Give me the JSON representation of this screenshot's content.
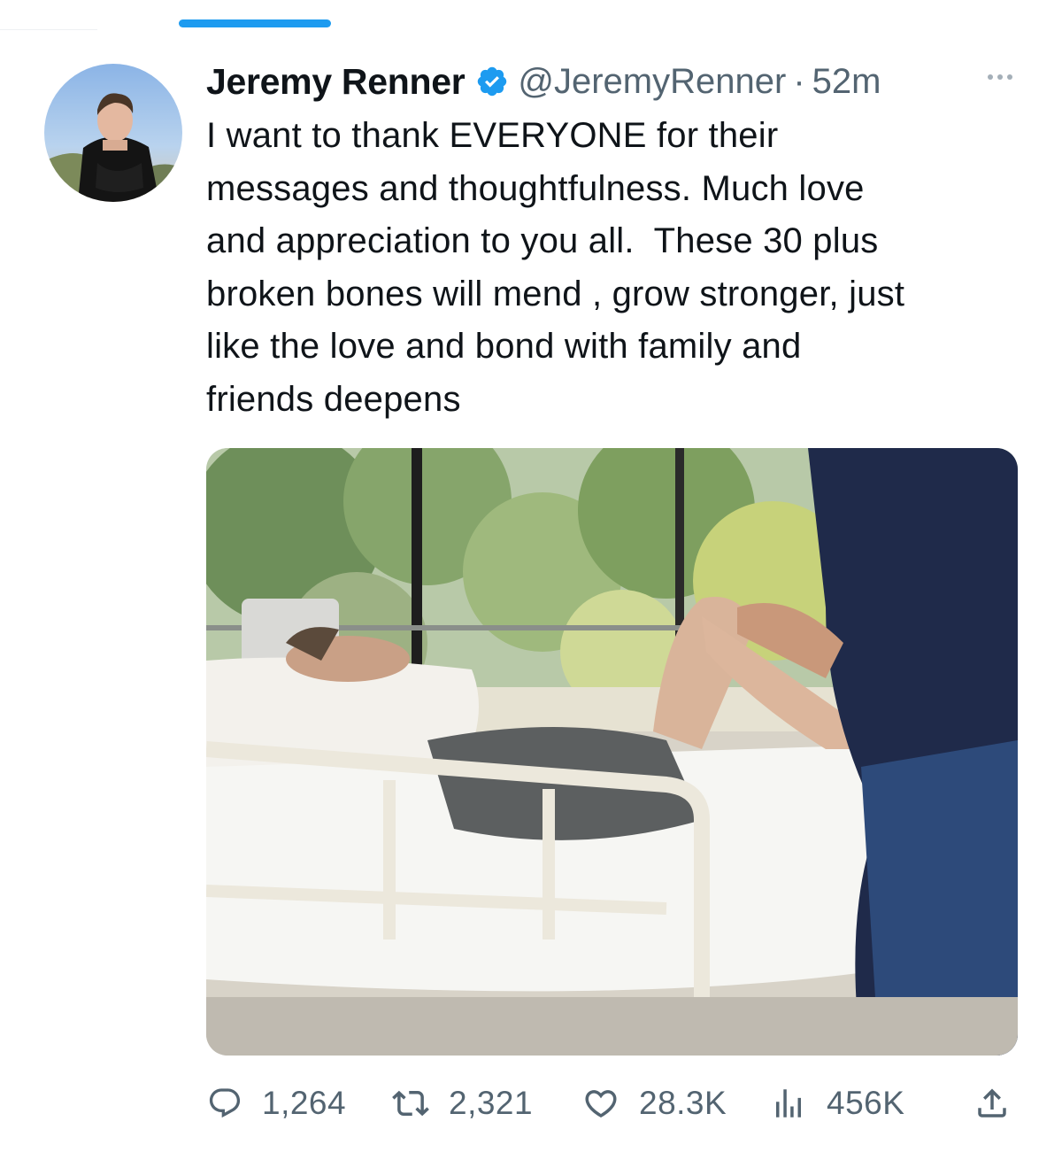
{
  "colors": {
    "accent": "#1d9bf0",
    "muted": "#536471",
    "text": "#0f1419"
  },
  "tweet": {
    "display_name": "Jeremy Renner",
    "handle": "@JeremyRenner",
    "separator": "·",
    "time": "52m",
    "text_lines": [
      "I want to thank EVERYONE for their",
      "messages and thoughtfulness. Much love",
      "and appreciation to you all.  These 30 plus",
      "broken bones will mend , grow stronger, just",
      "like the love and bond with family and",
      "friends deepens"
    ]
  },
  "icons": {
    "avatar": "profile-photo",
    "verified": "verified-badge-icon",
    "more": "more-dots-icon",
    "media": "hospital-bed-photo"
  },
  "actions": {
    "replies": {
      "icon": "reply-icon",
      "count": "1,264"
    },
    "retweets": {
      "icon": "retweet-icon",
      "count": "2,321"
    },
    "likes": {
      "icon": "heart-icon",
      "count": "28.3K"
    },
    "views": {
      "icon": "views-icon",
      "count": "456K"
    },
    "share": {
      "icon": "share-icon"
    }
  }
}
